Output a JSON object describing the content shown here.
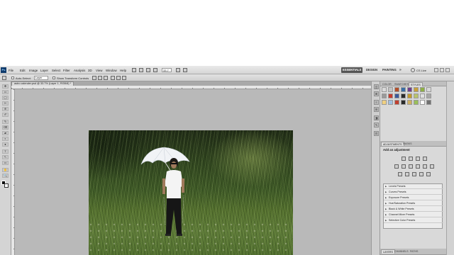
{
  "app": {
    "logo": "Ps"
  },
  "menu": {
    "items": [
      "File",
      "Edit",
      "Image",
      "Layer",
      "Select",
      "Filter",
      "Analysis",
      "3D",
      "View",
      "Window",
      "Help"
    ],
    "zoom": "33.7",
    "workspaces": [
      "ESSENTIALS",
      "DESIGN",
      "PAINTING",
      "»"
    ],
    "active_workspace": "ESSENTIALS",
    "cs_live": "CS Live"
  },
  "options": {
    "auto_select_label": "Auto-Select:",
    "auto_select_value": "Layer",
    "show_transform_label": "Show Transform Controls"
  },
  "document": {
    "tab_title": "astro calender.psd @ 33.7% (Layer 1, RGB/8) *"
  },
  "tools": [
    "✥",
    "▭",
    "◯",
    "✂",
    "⊕",
    "✐",
    "✎",
    "⌫",
    "▰",
    "◐",
    "●",
    "T",
    "↖",
    "▭",
    "✋",
    "🔍"
  ],
  "dock_icons": [
    "◫",
    "⊞",
    "≡",
    "☰",
    "◨",
    "✎",
    "⊡"
  ],
  "panels": {
    "top_tabs": [
      "COLOR",
      "SWATCHES",
      "STYLES"
    ],
    "active_top_tab": "STYLES",
    "style_colors": [
      "#d9d9d9",
      "#c2c2c2",
      "#b34f2a",
      "#3a6ea5",
      "#6f3f8c",
      "#c8a13a",
      "#8fb047",
      "#d8d8d8",
      "#9a9a9a",
      "#c63c2d",
      "#3c5a9a",
      "#2b2b2b",
      "#c49a2c",
      "#b9c46a",
      "#e0e0e0",
      "#a8a8a8",
      "#f0d080",
      "#a0c0e0",
      "#c04030",
      "#2a2a2a",
      "#d0b060",
      "#9abf5a",
      "#ffffff",
      "#707070"
    ],
    "adj_tabs": [
      "ADJUSTMENTS",
      "MASKS"
    ],
    "active_adj_tab": "ADJUSTMENTS",
    "adjust_title": "Add an adjustment",
    "presets": [
      "Levels Presets",
      "Curves Presets",
      "Exposure Presets",
      "Hue/Saturation Presets",
      "Black & White Presets",
      "Channel Mixer Presets",
      "Selective Color Presets"
    ],
    "bottom_tabs": [
      "LAYERS",
      "CHANNELS",
      "PATHS"
    ],
    "active_bottom_tab": "LAYERS"
  }
}
